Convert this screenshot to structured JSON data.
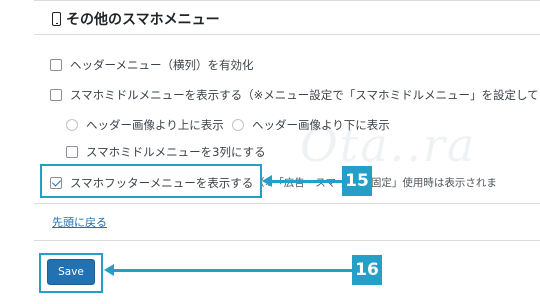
{
  "section": {
    "title": "その他のスマホメニュー"
  },
  "options": {
    "header_menu": "ヘッダーメニュー（横列）を有効化",
    "middle_menu": "スマホミドルメニューを表示する（※メニュー設定で「スマホミドルメニュー」を設定してく",
    "radio_above": "ヘッダー画像より上に表示",
    "radio_below": "ヘッダー画像より下に表示",
    "three_columns": "スマホミドルメニューを3列にする",
    "footer_menu": "スマホフッターメニューを表示する",
    "footer_note": "（※「広告・スマ      ターに固定」使用時は表示されま"
  },
  "link": {
    "back_to_top": "先頭に戻る"
  },
  "actions": {
    "save_label": "Save"
  },
  "callouts": {
    "footer_option": "15",
    "save": "16"
  },
  "watermark": "Ota..ra",
  "colors": {
    "accent": "#24a0c8",
    "button": "#2271b1"
  }
}
